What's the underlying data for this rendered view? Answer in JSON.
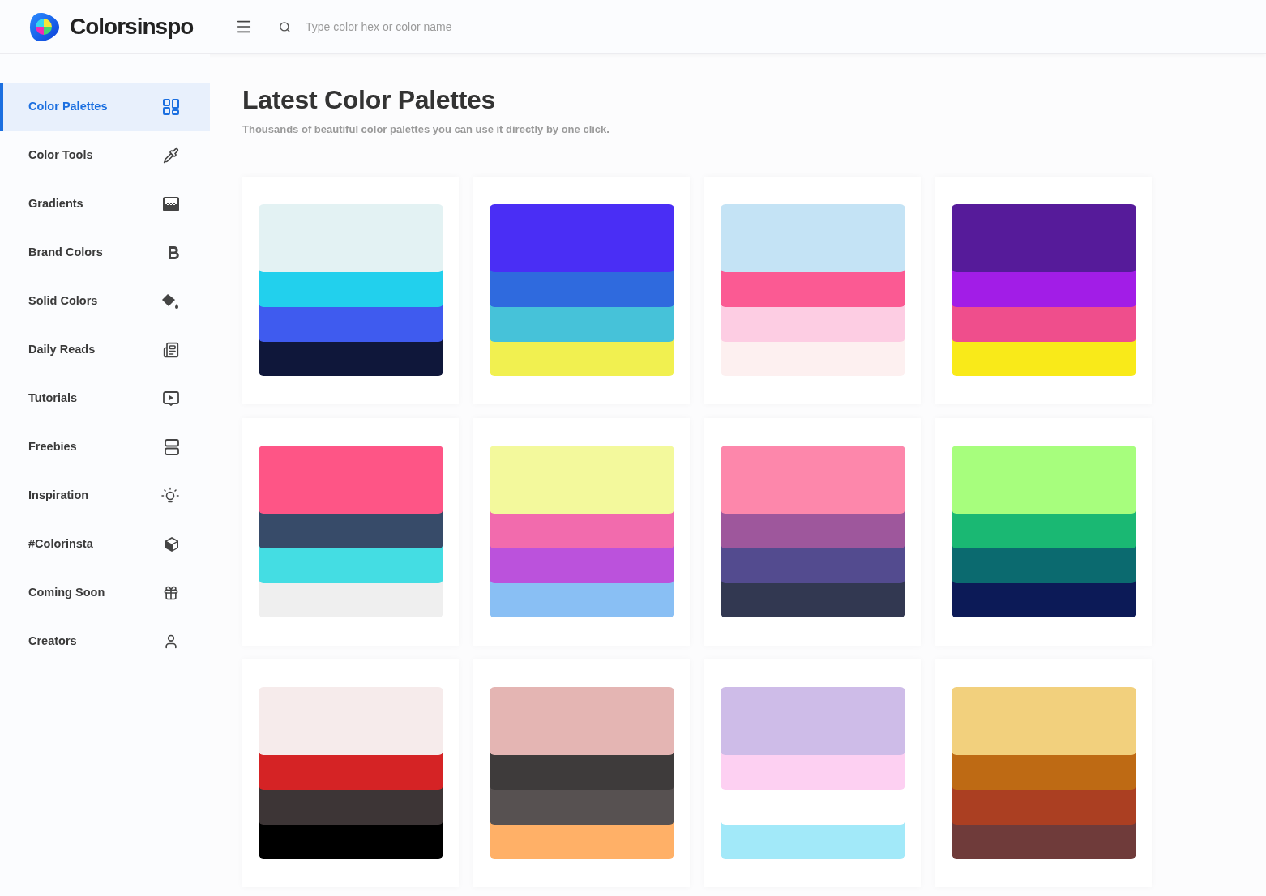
{
  "header": {
    "brand": "Colorsinspo",
    "search": {
      "placeholder": "Type color hex or color name"
    }
  },
  "sidebar": {
    "items": [
      {
        "label": "Color Palettes",
        "selected": true
      },
      {
        "label": "Color Tools",
        "selected": false
      },
      {
        "label": "Gradients",
        "selected": false
      },
      {
        "label": "Brand Colors",
        "selected": false
      },
      {
        "label": "Solid Colors",
        "selected": false
      },
      {
        "label": "Daily Reads",
        "selected": false
      },
      {
        "label": "Tutorials",
        "selected": false
      },
      {
        "label": "Freebies",
        "selected": false
      },
      {
        "label": "Inspiration",
        "selected": false
      },
      {
        "label": "#Colorinsta",
        "selected": false
      },
      {
        "label": "Coming Soon",
        "selected": false
      },
      {
        "label": "Creators",
        "selected": false
      }
    ]
  },
  "main": {
    "title": "Latest Color Palettes",
    "subtitle": "Thousands of beautiful color palettes you can use it directly by one click.",
    "palettes": [
      {
        "colors": [
          {
            "color": "#e3f2f3"
          },
          {
            "color": "#22d0ed"
          },
          {
            "color": "#3f5bef"
          },
          {
            "color": "#0f173a"
          }
        ]
      },
      {
        "colors": [
          {
            "color": "#4a2ef5"
          },
          {
            "color": "#2f6ade"
          },
          {
            "color": "#46c2d9"
          },
          {
            "color": "#f1f050"
          }
        ]
      },
      {
        "colors": [
          {
            "color": "#c4e3f5"
          },
          {
            "color": "#fb5a93"
          },
          {
            "color": "#fdcde3"
          },
          {
            "color": "#fdf0f0"
          }
        ]
      },
      {
        "colors": [
          {
            "color": "#561b9a"
          },
          {
            "color": "#a21de7"
          },
          {
            "color": "#ef4e8c"
          },
          {
            "color": "#f9ea19"
          }
        ]
      },
      {
        "colors": [
          {
            "color": "#fe5586"
          },
          {
            "color": "#374b69"
          },
          {
            "color": "#44dde3"
          },
          {
            "color": "#efefef"
          }
        ]
      },
      {
        "colors": [
          {
            "color": "#f3f99c"
          },
          {
            "color": "#f26bad"
          },
          {
            "color": "#bb52dc"
          },
          {
            "color": "#89bff4"
          }
        ]
      },
      {
        "colors": [
          {
            "color": "#fd87ab"
          },
          {
            "color": "#9e579c"
          },
          {
            "color": "#534b8f"
          },
          {
            "color": "#323851"
          }
        ]
      },
      {
        "colors": [
          {
            "color": "#a7fe7d"
          },
          {
            "color": "#1ab873"
          },
          {
            "color": "#0b6a6f"
          },
          {
            "color": "#0c1a57"
          }
        ]
      },
      {
        "colors": [
          {
            "color": "#f6ebeb"
          },
          {
            "color": "#d52325"
          },
          {
            "color": "#3d3536"
          },
          {
            "color": "#000000"
          }
        ]
      },
      {
        "colors": [
          {
            "color": "#e4b5b3"
          },
          {
            "color": "#3e3b3b"
          },
          {
            "color": "#575151"
          },
          {
            "color": "#ffb067"
          }
        ]
      },
      {
        "colors": [
          {
            "color": "#cebce8"
          },
          {
            "color": "#fdd0f2"
          },
          {
            "color": "#ffffff"
          },
          {
            "color": "#a2e9f9"
          }
        ]
      },
      {
        "colors": [
          {
            "color": "#f2d07d"
          },
          {
            "color": "#be6a14"
          },
          {
            "color": "#ab3f22"
          },
          {
            "color": "#6f3b3a"
          }
        ]
      }
    ]
  }
}
